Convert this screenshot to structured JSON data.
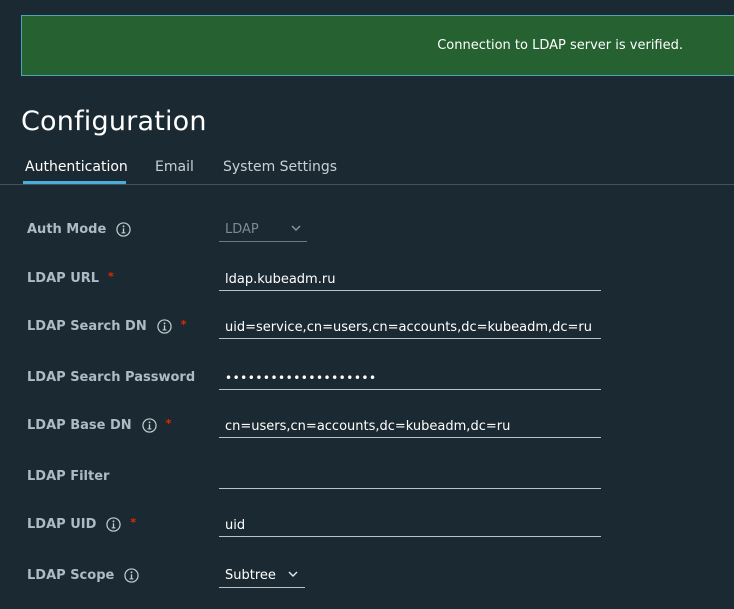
{
  "banner": {
    "message": "Connection to LDAP server is verified."
  },
  "page": {
    "title": "Configuration"
  },
  "tabs": [
    {
      "label": "Authentication",
      "active": true
    },
    {
      "label": "Email",
      "active": false
    },
    {
      "label": "System Settings",
      "active": false
    }
  ],
  "form": {
    "auth_mode": {
      "label": "Auth Mode",
      "value": "LDAP",
      "disabled": true,
      "has_info": true,
      "required": false
    },
    "ldap_url": {
      "label": "LDAP URL",
      "value": "ldap.kubeadm.ru",
      "has_info": false,
      "required": true
    },
    "ldap_search_dn": {
      "label": "LDAP Search DN",
      "value": "uid=service,cn=users,cn=accounts,dc=kubeadm,dc=ru",
      "has_info": true,
      "required": true
    },
    "ldap_search_password": {
      "label": "LDAP Search Password",
      "value": "••••••••••••••••••••",
      "has_info": false,
      "required": false
    },
    "ldap_base_dn": {
      "label": "LDAP Base DN",
      "value": "cn=users,cn=accounts,dc=kubeadm,dc=ru",
      "has_info": true,
      "required": true
    },
    "ldap_filter": {
      "label": "LDAP Filter",
      "value": "",
      "has_info": false,
      "required": false
    },
    "ldap_uid": {
      "label": "LDAP UID",
      "value": "uid",
      "has_info": true,
      "required": true
    },
    "ldap_scope": {
      "label": "LDAP Scope",
      "value": "Subtree",
      "has_info": true,
      "required": false
    }
  },
  "required_marker": "*",
  "colors": {
    "background": "#1b2a32",
    "banner_bg": "#266131",
    "banner_border": "#4aa7b8",
    "tab_active_underline": "#49afd9",
    "required": "#e62700"
  },
  "icons": {
    "info": "info-circle-icon",
    "dropdown": "chevron-down-icon"
  }
}
